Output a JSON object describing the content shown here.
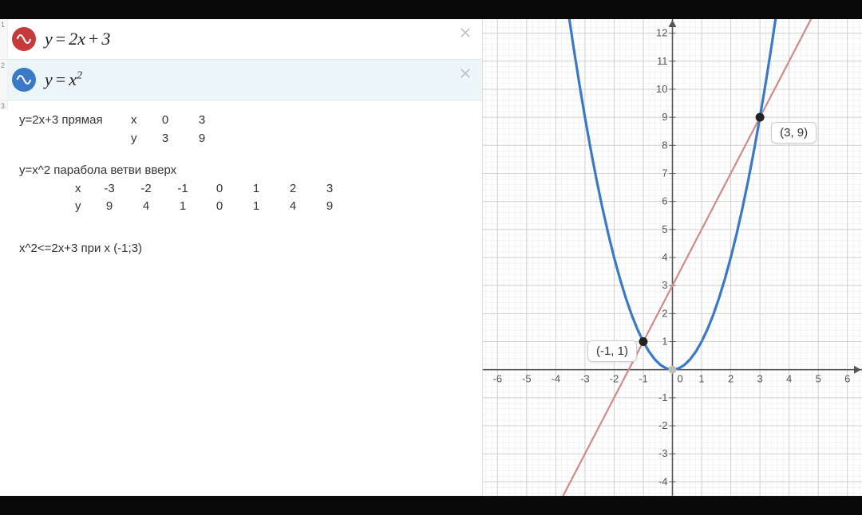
{
  "rows": [
    {
      "idx": "1",
      "color": "#c63a3a",
      "eq_html": "<span>y</span><span class='op'>=</span><span>2x</span><span class='op'>+</span><span>3</span>"
    },
    {
      "idx": "2",
      "color": "#3a79c6",
      "eq_html": "<span>y</span><span class='op'>=</span><span>x</span><span class='sup'>2</span>",
      "active": true
    },
    {
      "idx": "3",
      "notes": true
    }
  ],
  "notes": {
    "line_desc": "y=2x+3  прямая",
    "line_table": {
      "headers": [
        "x",
        "0",
        "3"
      ],
      "row2": [
        "y",
        "3",
        "9"
      ]
    },
    "para_desc": "y=x^2    парабола ветви вверх",
    "para_table": {
      "headers": [
        "x",
        "-3",
        "-2",
        "-1",
        "0",
        "1",
        "2",
        "3"
      ],
      "row2": [
        "y",
        "9",
        "4",
        "1",
        "0",
        "1",
        "4",
        "9"
      ]
    },
    "inequality": "x^2<=2x+3    при x  (-1;3)"
  },
  "chart_data": {
    "type": "line",
    "title": "",
    "xlabel": "",
    "ylabel": "",
    "xlim": [
      -6.5,
      6.5
    ],
    "ylim": [
      -4.5,
      12.5
    ],
    "x_ticks": [
      -6,
      -5,
      -4,
      -3,
      -2,
      -1,
      0,
      1,
      2,
      3,
      4,
      5,
      6
    ],
    "y_ticks": [
      -4,
      -3,
      -2,
      -1,
      0,
      1,
      2,
      3,
      4,
      5,
      6,
      7,
      8,
      9,
      10,
      11,
      12
    ],
    "grid": true,
    "minor_grid_div": 5,
    "series": [
      {
        "name": "y = 2x + 3",
        "type": "line",
        "color": "#d08a8a",
        "x": [
          -4,
          6
        ],
        "y": [
          -5,
          15
        ]
      },
      {
        "name": "y = x^2",
        "type": "line",
        "color": "#3a79c6",
        "x": [
          -3.6,
          -3.4,
          -3.2,
          -3,
          -2.8,
          -2.6,
          -2.4,
          -2.2,
          -2,
          -1.8,
          -1.6,
          -1.4,
          -1.2,
          -1,
          -0.8,
          -0.6,
          -0.4,
          -0.2,
          0,
          0.2,
          0.4,
          0.6,
          0.8,
          1,
          1.2,
          1.4,
          1.6,
          1.8,
          2,
          2.2,
          2.4,
          2.6,
          2.8,
          3,
          3.2,
          3.4,
          3.6
        ],
        "y": [
          12.96,
          11.56,
          10.24,
          9,
          7.84,
          6.76,
          5.76,
          4.84,
          4,
          3.24,
          2.56,
          1.96,
          1.44,
          1,
          0.64,
          0.36,
          0.16,
          0.04,
          0,
          0.04,
          0.16,
          0.36,
          0.64,
          1,
          1.44,
          1.96,
          2.56,
          3.24,
          4,
          4.84,
          5.76,
          6.76,
          7.84,
          9,
          10.24,
          11.56,
          12.96
        ]
      }
    ],
    "points": [
      {
        "x": -1,
        "y": 1,
        "label": "(-1, 1)"
      },
      {
        "x": 3,
        "y": 9,
        "label": "(3, 9)"
      }
    ],
    "origin_marker": {
      "x": 0,
      "y": 0
    }
  },
  "colors": {
    "line": "#d08a8a",
    "parabola": "#3a79c6",
    "grid_minor": "#e8e8e8",
    "grid_major": "#cfcfcf",
    "axis": "#555"
  }
}
